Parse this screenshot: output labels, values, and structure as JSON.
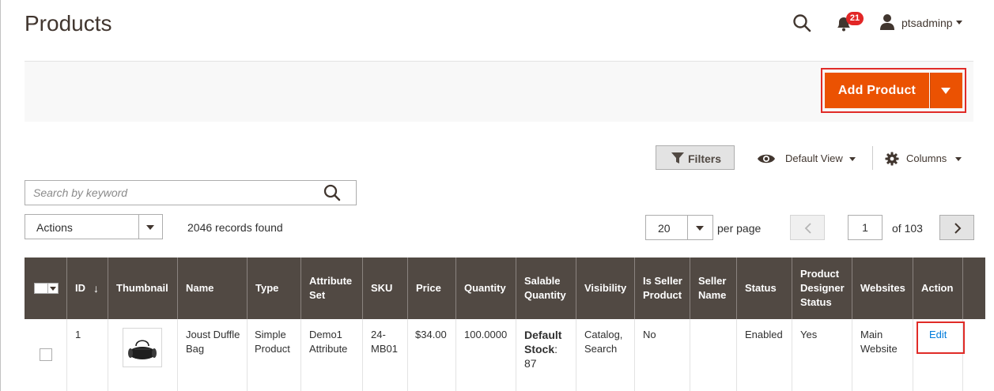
{
  "header": {
    "title": "Products",
    "notifications_count": "21",
    "username": "ptsadminp"
  },
  "actions_bar": {
    "add_product_label": "Add Product"
  },
  "toolbar": {
    "filters_label": "Filters",
    "view_label": "Default View",
    "columns_label": "Columns"
  },
  "search": {
    "placeholder": "Search by keyword",
    "value": ""
  },
  "mass_actions": {
    "label": "Actions",
    "records_found": "2046 records found"
  },
  "pagination": {
    "per_page_value": "20",
    "per_page_label": "per page",
    "current_page": "1",
    "total_pages_label": "of 103"
  },
  "table": {
    "columns": {
      "id": "ID",
      "id_sort": "↓",
      "thumbnail": "Thumbnail",
      "name": "Name",
      "type": "Type",
      "attribute_set": "Attribute Set",
      "sku": "SKU",
      "price": "Price",
      "quantity": "Quantity",
      "salable_quantity": "Salable Quantity",
      "visibility": "Visibility",
      "is_seller_product": "Is Seller Product",
      "seller_name": "Seller Name",
      "status": "Status",
      "product_designer_status": "Product Designer Status",
      "websites": "Websites",
      "action": "Action"
    },
    "rows": [
      {
        "id": "1",
        "name": "Joust Duffle Bag",
        "type": "Simple Product",
        "attribute_set": "Demo1 Attribute",
        "sku": "24-MB01",
        "price": "$34.00",
        "quantity": "100.0000",
        "salable_stock_label": "Default Stock",
        "salable_stock_value": ": 87",
        "visibility": "Catalog, Search",
        "is_seller_product": "No",
        "seller_name": "",
        "status": "Enabled",
        "product_designer_status": "Yes",
        "websites": "Main Website",
        "action": "Edit"
      }
    ]
  },
  "colors": {
    "accent": "#eb5202",
    "header_bg": "#514943",
    "highlight": "#e02b27",
    "link": "#007bdb",
    "badge": "#e22626"
  }
}
